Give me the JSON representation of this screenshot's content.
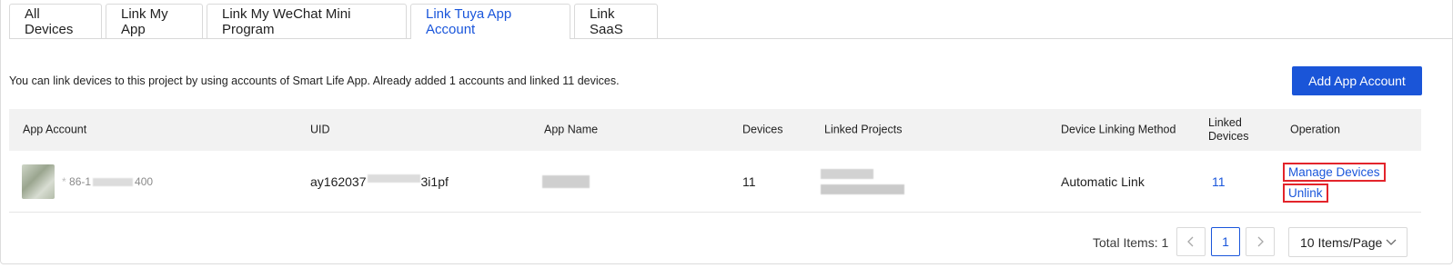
{
  "tabs": [
    {
      "label": "All Devices",
      "active": false
    },
    {
      "label": "Link My App",
      "active": false
    },
    {
      "label": "Link My WeChat Mini Program",
      "active": false
    },
    {
      "label": "Link Tuya App Account",
      "active": true
    },
    {
      "label": "Link SaaS",
      "active": false
    }
  ],
  "info_text": "You can link devices to this project by using accounts of Smart Life App. Already added 1 accounts and linked 11 devices.",
  "add_button_label": "Add App Account",
  "table": {
    "headers": {
      "app_account": "App Account",
      "uid": "UID",
      "app_name": "App Name",
      "devices": "Devices",
      "linked_projects": "Linked Projects",
      "linking_method": "Device Linking Method",
      "linked_devices_1": "Linked",
      "linked_devices_2": "Devices",
      "operation": "Operation"
    },
    "rows": [
      {
        "account_prefix": "86-1",
        "account_suffix": "400",
        "uid_prefix": "ay162037",
        "uid_suffix": "3i1pf",
        "devices": "11",
        "linking_method": "Automatic Link",
        "linked_devices": "11",
        "op_manage": "Manage Devices",
        "op_unlink": "Unlink"
      }
    ]
  },
  "pagination": {
    "total_label": "Total Items: 1",
    "prev": "<",
    "current_page": "1",
    "next": ">",
    "page_size": "10 Items/Page"
  },
  "colors": {
    "accent": "#1a56db",
    "highlight_box": "#e3242b",
    "header_bg": "#f2f2f2"
  }
}
